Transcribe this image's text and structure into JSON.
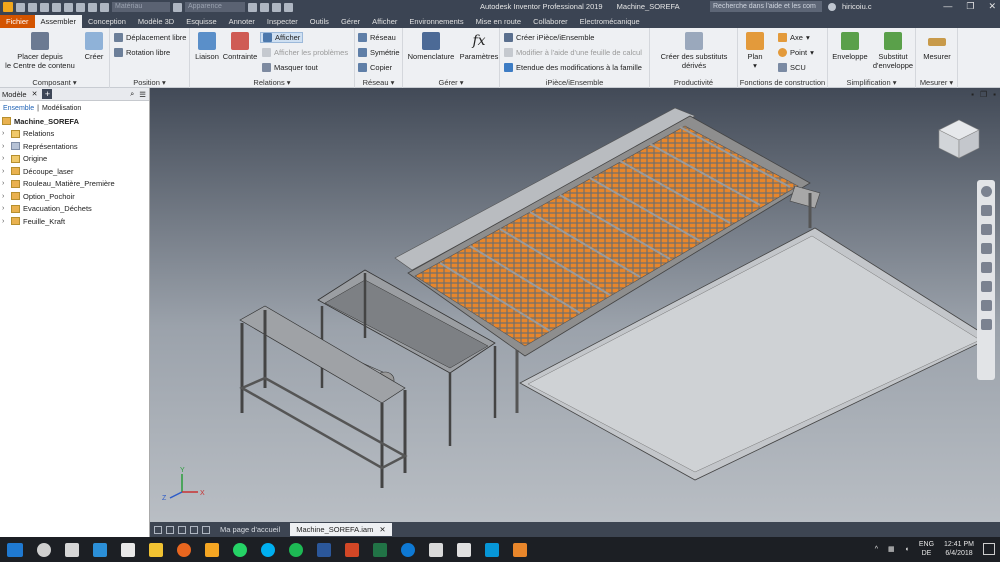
{
  "titlebar": {
    "app_title": "Autodesk Inventor Professional 2019",
    "document": "Machine_SOREFA",
    "material_placeholder": "Matériau",
    "appearance_placeholder": "Apparence",
    "search_placeholder": "Recherche dans l'aide et les com",
    "user": "hiricoiu.c"
  },
  "tabs": [
    "Fichier",
    "Assembler",
    "Conception",
    "Modèle 3D",
    "Esquisse",
    "Annoter",
    "Inspecter",
    "Outils",
    "Gérer",
    "Afficher",
    "Environnements",
    "Mise en route",
    "Collaborer",
    "Electromécanique"
  ],
  "ribbon": {
    "composant": {
      "label": "Composant",
      "place": "Placer depuis le Centre de contenu",
      "place1": "Placer depuis",
      "place2": "le Centre de contenu",
      "create": "Créer"
    },
    "position": {
      "label": "Position",
      "free_move": "Déplacement libre",
      "free_rotate": "Rotation libre"
    },
    "relations": {
      "label": "Relations",
      "joint": "Liaison",
      "constraint": "Contrainte",
      "show": "Afficher",
      "show_problems": "Afficher les problèmes",
      "hide_all": "Masquer tout"
    },
    "reseau": {
      "label": "Réseau",
      "pattern": "Réseau",
      "mirror": "Symétrie",
      "copy": "Copier"
    },
    "gerer": {
      "label": "Gérer",
      "bom": "Nomenclature",
      "params": "Paramètres"
    },
    "ipiece": {
      "label": "iPièce/iEnsemble",
      "create": "Créer iPièce/iEnsemble",
      "modify": "Modifier à l'aide d'une feuille de calcul",
      "scope": "Etendue des modifications à la famille"
    },
    "productivite": {
      "label": "Productivité",
      "derived": "Créer des substituts dérivés",
      "derived1": "Créer des substituts",
      "derived2": "dérivés"
    },
    "construction": {
      "label": "Fonctions de construction",
      "plane": "Plan",
      "axis": "Axe",
      "point": "Point",
      "ucs": "SCU"
    },
    "simplification": {
      "label": "Simplification",
      "envelope": "Enveloppe",
      "envelope_sub": "Substitut d'enveloppe",
      "envelope_sub1": "Substitut",
      "envelope_sub2": "d'enveloppe"
    },
    "mesurer": {
      "label": "Mesurer",
      "measure": "Mesurer"
    }
  },
  "panel": {
    "title": "Modèle",
    "subtabs": [
      "Ensemble",
      "Modélisation"
    ],
    "root": "Machine_SOREFA",
    "items": [
      "Relations",
      "Représentations",
      "Origine",
      "Découpe_laser",
      "Rouleau_Matière_Première",
      "Option_Pochoir",
      "Evacuation_Déchets",
      "Feuille_Kraft"
    ]
  },
  "doctabs": [
    "Ma page d'accueil",
    "Machine_SOREFA.iam"
  ],
  "tray": {
    "lang1": "ENG",
    "lang2": "DE",
    "time": "12:41 PM",
    "date": "6/4/2018"
  },
  "colors": {
    "ribbon_bg": "#eef0f3",
    "titlebar": "#3b4453",
    "file_tab": "#d35400",
    "tray_bg": "#1c1f24",
    "accent_orange": "#e8862b"
  }
}
